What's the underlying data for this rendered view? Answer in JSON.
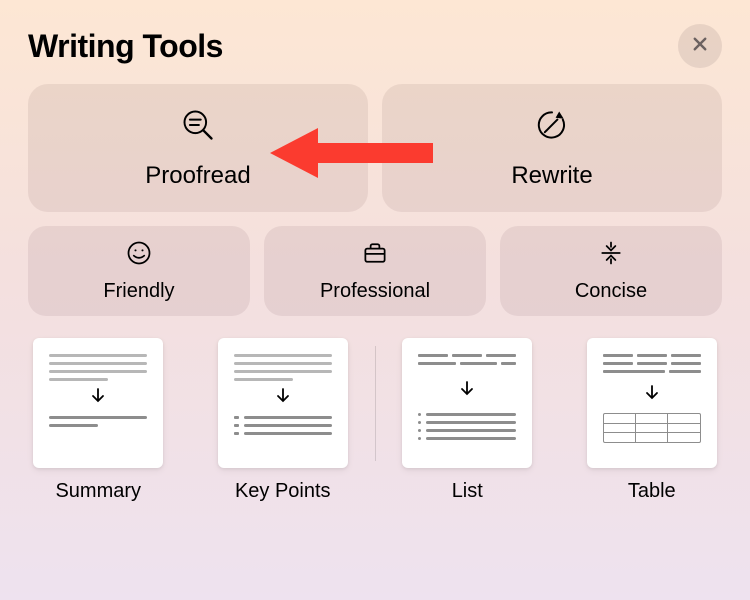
{
  "header": {
    "title": "Writing Tools"
  },
  "primary_actions": {
    "proofread": "Proofread",
    "rewrite": "Rewrite"
  },
  "tone_actions": {
    "friendly": "Friendly",
    "professional": "Professional",
    "concise": "Concise"
  },
  "format_actions": {
    "summary": "Summary",
    "key_points": "Key Points",
    "list": "List",
    "table": "Table"
  },
  "icons": {
    "close": "close-icon",
    "proofread": "magnifier-lines-icon",
    "rewrite": "circular-pencil-icon",
    "friendly": "smile-icon",
    "professional": "briefcase-icon",
    "concise": "collapse-icon"
  },
  "annotation": {
    "pointer": "arrow-left-red",
    "target": "proofread-button",
    "color": "#fb3b2f"
  }
}
